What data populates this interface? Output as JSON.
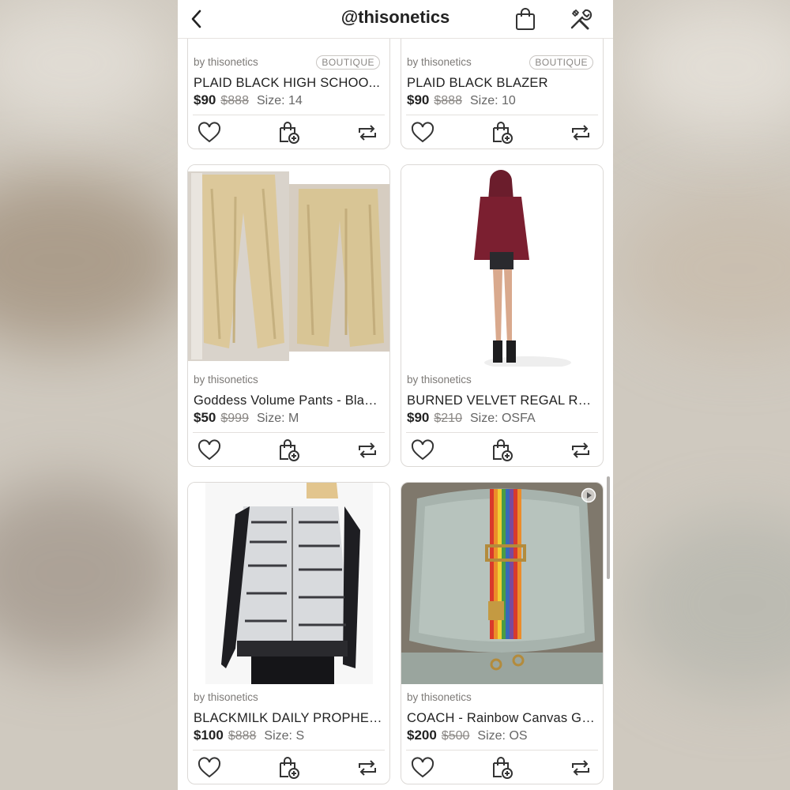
{
  "header": {
    "title": "@thisonetics",
    "back_icon": "chevron-left-icon",
    "bag_icon": "shopping-bag-icon",
    "tools_icon": "tools-icon"
  },
  "listings": [
    {
      "seller": "by thisonetics",
      "badge": "BOUTIQUE",
      "title": "PLAID BLACK HIGH SCHOO...",
      "price": "$90",
      "original_price": "$888",
      "size": "Size: 14",
      "image": "plaid-skirt-photo"
    },
    {
      "seller": "by thisonetics",
      "badge": "BOUTIQUE",
      "title": "PLAID BLACK BLAZER",
      "price": "$90",
      "original_price": "$888",
      "size": "Size: 10",
      "image": "plaid-blazer-photo"
    },
    {
      "seller": "by thisonetics",
      "badge": "",
      "title": "Goddess Volume Pants - Black...",
      "price": "$50",
      "original_price": "$999",
      "size": "Size: M",
      "image": "gold-pants-photo"
    },
    {
      "seller": "by thisonetics",
      "badge": "",
      "title": "BURNED VELVET REGAL RED...",
      "price": "$90",
      "original_price": "$210",
      "size": "Size: OSFA",
      "image": "red-velvet-cape-model-photo"
    },
    {
      "seller": "by thisonetics",
      "badge": "",
      "title": "BLACKMILK DAILY PROPHET...",
      "price": "$100",
      "original_price": "$888",
      "size": "Size: S",
      "image": "newspaper-print-jacket-photo"
    },
    {
      "seller": "by thisonetics",
      "badge": "",
      "title": "COACH - Rainbow Canvas Gu...",
      "price": "$200",
      "original_price": "$500",
      "size": "Size: OS",
      "image": "rainbow-strap-on-chair-photo",
      "video_icon": "play-circle-icon"
    }
  ],
  "action_icons": [
    "heart-icon",
    "bundle-add-icon",
    "share-icon"
  ],
  "colors": {
    "text_primary": "#222222",
    "text_secondary": "#7d7a77",
    "card_border": "#dcd9d6"
  }
}
